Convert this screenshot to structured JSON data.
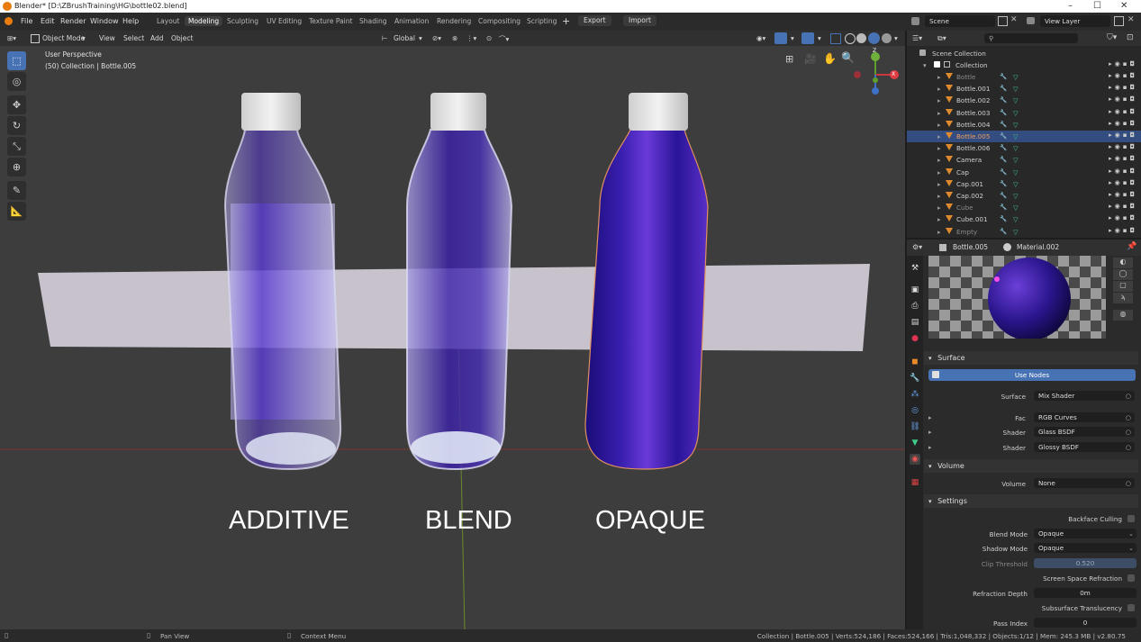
{
  "window": {
    "title": "Blender* [D:\\ZBrushTraining\\HG\\bottle02.blend]",
    "controls": [
      "–",
      "☐",
      "✕"
    ]
  },
  "menu": {
    "items": [
      "File",
      "Edit",
      "Render",
      "Window",
      "Help"
    ],
    "workspaces": [
      "Layout",
      "Modeling",
      "Sculpting",
      "UV Editing",
      "Texture Paint",
      "Shading",
      "Animation",
      "Rendering",
      "Compositing",
      "Scripting"
    ],
    "active_workspace": "Modeling",
    "add_tab": "+",
    "export_label": "Export",
    "import_label": "Import",
    "scene_label": "Scene",
    "view_layer_label": "View Layer"
  },
  "viewport_header": {
    "mode": "Object Mode",
    "menus": [
      "View",
      "Select",
      "Add",
      "Object"
    ],
    "transform": "Global"
  },
  "viewport": {
    "perspective": "User Perspective",
    "collection": "(50) Collection | Bottle.005",
    "captions": [
      "ADDITIVE",
      "BLEND",
      "OPAQUE"
    ],
    "gizmo": {
      "x": "X",
      "y": "Y",
      "z": "Z"
    },
    "colors": {
      "background": "#3d3d3d",
      "liquid": "#3a1fb0",
      "plane": "#c7c2cc"
    }
  },
  "outliner": {
    "scene_collection": "Scene Collection",
    "collection": "Collection",
    "items": [
      {
        "name": "Bottle",
        "dim": true
      },
      {
        "name": "Bottle.001"
      },
      {
        "name": "Bottle.002"
      },
      {
        "name": "Bottle.003"
      },
      {
        "name": "Bottle.004"
      },
      {
        "name": "Bottle.005",
        "selected": true
      },
      {
        "name": "Bottle.006"
      },
      {
        "name": "Camera"
      },
      {
        "name": "Cap"
      },
      {
        "name": "Cap.001"
      },
      {
        "name": "Cap.002"
      },
      {
        "name": "Cube",
        "dim": true
      },
      {
        "name": "Cube.001"
      },
      {
        "name": "Empty",
        "dim": true
      }
    ]
  },
  "properties": {
    "object": "Bottle.005",
    "material": "Material.002",
    "surface": {
      "title": "Surface",
      "use_nodes": "Use Nodes",
      "rows": [
        {
          "label": "Surface",
          "value": "Mix Shader"
        },
        {
          "label": "Fac",
          "value": "RGB Curves"
        },
        {
          "label": "Shader",
          "value": "Glass BSDF"
        },
        {
          "label": "Shader",
          "value": "Glossy BSDF"
        }
      ]
    },
    "volume": {
      "title": "Volume",
      "label": "Volume",
      "value": "None"
    },
    "settings": {
      "title": "Settings",
      "backface_culling": "Backface Culling",
      "blend_mode_label": "Blend Mode",
      "blend_mode": "Opaque",
      "shadow_mode_label": "Shadow Mode",
      "shadow_mode": "Opaque",
      "clip_threshold_label": "Clip Threshold",
      "clip_threshold": "0.520",
      "ssr_label": "Screen Space Refraction",
      "refraction_depth_label": "Refraction Depth",
      "refraction_depth": "0m",
      "subsurface_label": "Subsurface Translucency",
      "pass_index_label": "Pass Index",
      "pass_index": "0"
    }
  },
  "status": {
    "pan": "Pan View",
    "context": "Context Menu",
    "stats": "Collection | Bottle.005 | Verts:524,186 | Faces:524,166 | Tris:1,048,332 | Objects:1/12 | Mem: 245.3 MB | v2.80.75"
  }
}
